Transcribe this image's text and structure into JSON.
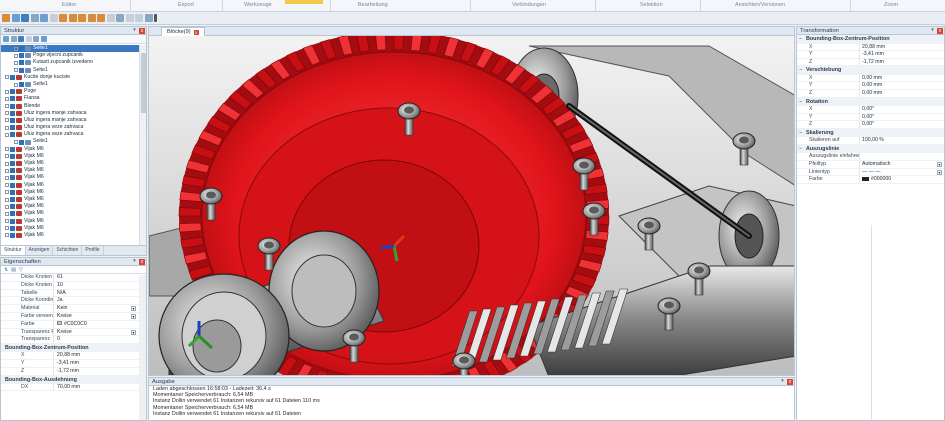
{
  "ribbon": {
    "groups": [
      "Editor",
      "Export",
      "Werkzeuge",
      "Bearbeitung",
      "Verbindungen",
      "Selektion",
      "Ansichten/Versionen",
      "Zoom"
    ]
  },
  "structure": {
    "title": "Struktur",
    "items": [
      {
        "label": "Seite1",
        "selected": true,
        "depth": 1
      },
      {
        "label": "Poge vijecni zupcanik",
        "depth": 1
      },
      {
        "label": "Kutasti zupcanik izvedeno",
        "depth": 1
      },
      {
        "label": "Seite1",
        "depth": 1
      },
      {
        "label": "Kucite donje kuciste",
        "depth": 0
      },
      {
        "label": "Seite1",
        "depth": 1
      },
      {
        "label": "Poge",
        "depth": 0
      },
      {
        "label": "Flansa",
        "depth": 0
      },
      {
        "label": "Blende",
        "depth": 0
      },
      {
        "label": "Uluz ingera manje zahvaca",
        "depth": 0
      },
      {
        "label": "Uluz ingera manje zahvaca",
        "depth": 0
      },
      {
        "label": "Uluz ingera veze zahvaca",
        "depth": 0
      },
      {
        "label": "Uluz ingera veze zahvaca",
        "depth": 0
      },
      {
        "label": "Seite1",
        "depth": 1
      },
      {
        "label": "Vijak M6",
        "depth": 0
      },
      {
        "label": "Vijak M6",
        "depth": 0
      },
      {
        "label": "Vijak M6",
        "depth": 0
      },
      {
        "label": "Vijak M6",
        "depth": 0
      },
      {
        "label": "Vijak M6",
        "depth": 0
      },
      {
        "label": "Vijak M6",
        "depth": 0
      },
      {
        "label": "Vijak M6",
        "depth": 0
      },
      {
        "label": "Vijak M6",
        "depth": 0
      },
      {
        "label": "Vijak M6",
        "depth": 0
      },
      {
        "label": "Vijak M6",
        "depth": 0
      },
      {
        "label": "Vijak M6",
        "depth": 0
      },
      {
        "label": "Vijak M6",
        "depth": 0
      },
      {
        "label": "Vijak M6",
        "depth": 0
      }
    ],
    "tabs": [
      "Struktur",
      "Anzeigen",
      "Schichten",
      "Profile"
    ]
  },
  "properties": {
    "title": "Eigenschaften",
    "rows": [
      {
        "k": "Dicke Knoten",
        "v": "61"
      },
      {
        "k": "Dicke Knoten wie",
        "v": "10"
      },
      {
        "k": "Tabelle",
        "v": "N/A"
      },
      {
        "k": "Dicke Koordinaten",
        "v": "Ja"
      },
      {
        "k": "Material",
        "v": "Kein",
        "dd": true
      },
      {
        "k": "Farbe verwenden",
        "v": "Kreise",
        "dd": true
      },
      {
        "k": "Farbe",
        "v": "#C0C0C0",
        "swatch": true
      },
      {
        "k": "Transparenz Form",
        "v": "Kreise",
        "dd": true
      },
      {
        "k": "Transparenz",
        "v": "0"
      }
    ],
    "section1": "Bounding-Box-Zentrum-Position",
    "bb_rows": [
      {
        "k": "X",
        "v": "20,88 mm"
      },
      {
        "k": "Y",
        "v": "-3,41 mm"
      },
      {
        "k": "Z",
        "v": "-1,72 mm"
      }
    ],
    "section2": "Bounding-Box-Ausdehnung",
    "ext_rows": [
      {
        "k": "DX",
        "v": "70,00 mm"
      }
    ]
  },
  "viewport": {
    "tab_label": "Blöcke(9)",
    "close": "x"
  },
  "output": {
    "title": "Ausgabe",
    "lines": [
      "Laden abgeschlossen 16:58:03 - Ladezeit: 36,4 s",
      "Momentaner Speicherverbrauch: 6,54 MB",
      "Instanz Dollin verwendet 61 Instanzen rekursiv auf 61 Dateien 110 ms",
      "Momentaner Speicherverbrauch: 6,54 MB",
      "Instanz Dollin verwendet 61 Instanzen rekursiv auf 61 Dateien"
    ]
  },
  "transform": {
    "title": "Transformation",
    "sections": [
      {
        "title": "Bounding-Box-Zentrum-Position",
        "rows": [
          {
            "k": "X",
            "v": "20,88 mm"
          },
          {
            "k": "Y",
            "v": "-3,41 mm"
          },
          {
            "k": "Z",
            "v": "-1,72 mm"
          }
        ]
      },
      {
        "title": "Verschiebung",
        "rows": [
          {
            "k": "X",
            "v": "0,00 mm"
          },
          {
            "k": "Y",
            "v": "0,00 mm"
          },
          {
            "k": "Z",
            "v": "0,00 mm"
          }
        ]
      },
      {
        "title": "Rotation",
        "rows": [
          {
            "k": "X",
            "v": "0,00°"
          },
          {
            "k": "Y",
            "v": "0,00°"
          },
          {
            "k": "Z",
            "v": "0,00°"
          }
        ]
      },
      {
        "title": "Skalierung",
        "rows": [
          {
            "k": "Skalieren auf",
            "v": "100,00 %"
          }
        ]
      },
      {
        "title": "Auszugslinie",
        "rows": [
          {
            "k": "Auszugslinie einfahren",
            "v": ""
          },
          {
            "k": "Pfeiltyp",
            "v": "Automatisch",
            "dd": true
          },
          {
            "k": "Linientyp",
            "v": "— — —",
            "dd": true
          },
          {
            "k": "Farbe",
            "v": "#000000",
            "swatch": true
          }
        ]
      }
    ]
  },
  "colors": {
    "gear_red": "#e0141a",
    "selection_blue": "#3b78c2",
    "ribbon_highlight": "#f2c94c"
  }
}
